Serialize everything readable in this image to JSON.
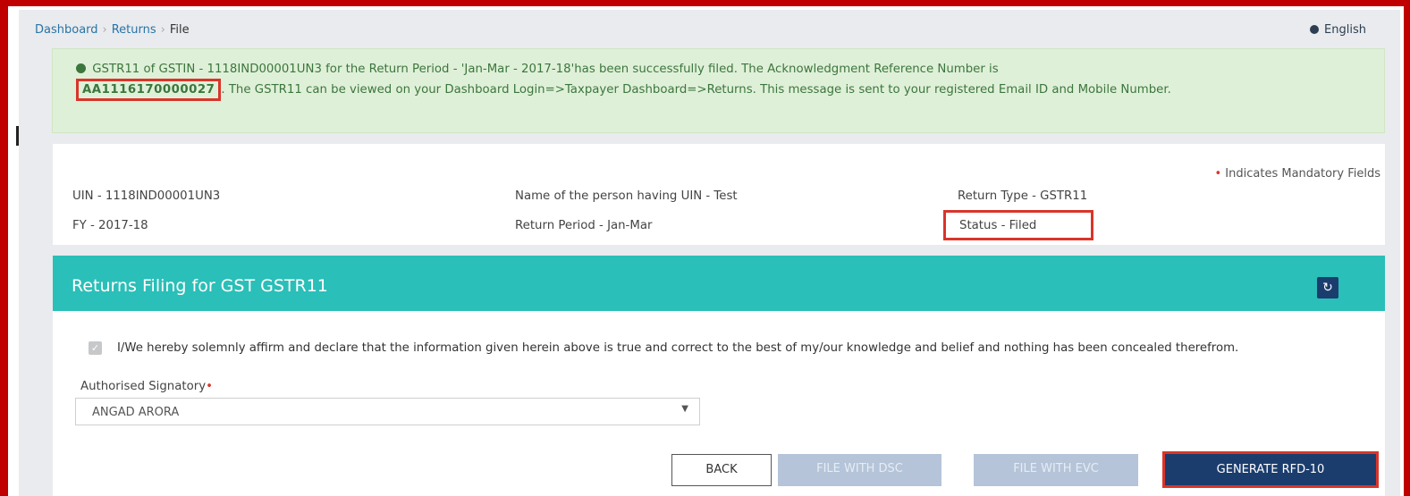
{
  "breadcrumb": {
    "dashboard": "Dashboard",
    "returns": "Returns",
    "current": "File"
  },
  "language": "English",
  "alert": {
    "line1": "GSTR11 of GSTIN - 1118IND00001UN3 for the Return Period - 'Jan-Mar - 2017-18'has been successfully filed. The Acknowledgment Reference Number is",
    "ack_number": "AA1116170000027",
    "line2": ". The GSTR11 can be viewed on your Dashboard Login=>Taxpayer Dashboard=>Returns. This message is sent to your registered Email ID and Mobile Number."
  },
  "info": {
    "mandatory_note": "Indicates Mandatory Fields",
    "uin": "UIN - 1118IND00001UN3",
    "name": "Name of the person having UIN - Test",
    "return_type": "Return Type - GSTR11",
    "fy": "FY - 2017-18",
    "return_period": "Return Period - Jan-Mar",
    "status": "Status - Filed"
  },
  "filing": {
    "title": "Returns Filing for GST GSTR11",
    "refresh_icon": "refresh-icon",
    "declaration": "I/We hereby solemnly affirm and declare that the information given herein above is true and correct to the best of my/our knowledge and belief and nothing has been concealed therefrom.",
    "declaration_checked": true,
    "signatory_label": "Authorised Signatory",
    "signatory_value": "ANGAD ARORA"
  },
  "buttons": {
    "back": "BACK",
    "file_dsc": "FILE WITH DSC",
    "file_evc": "FILE WITH EVC",
    "generate_rfd": "GENERATE RFD-10"
  },
  "colors": {
    "highlight_border": "#d9352a",
    "header_teal": "#2abfb8",
    "primary_navy": "#1b3d6e",
    "success_bg": "#dff0d8"
  }
}
